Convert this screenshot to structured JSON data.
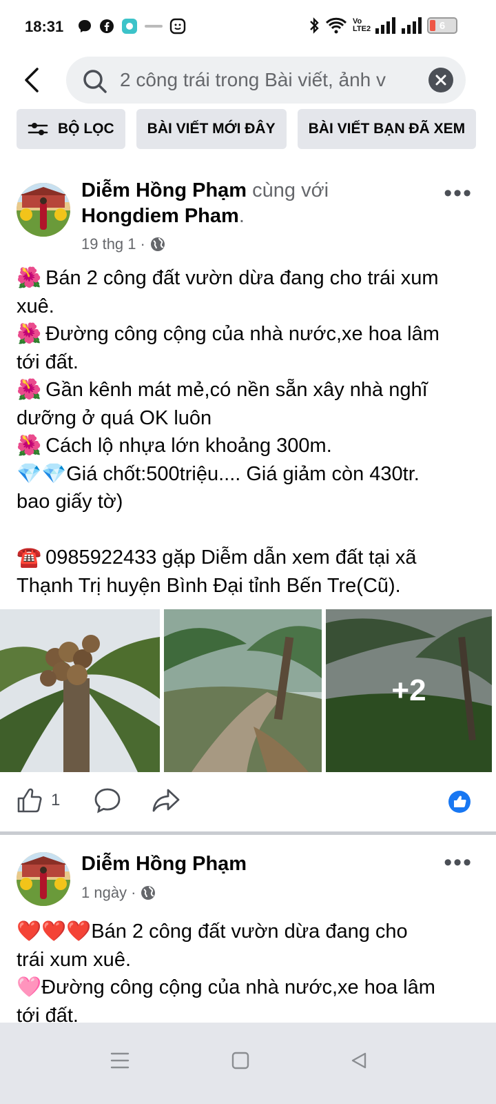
{
  "status_bar": {
    "time": "18:31",
    "battery": "6",
    "network_label": "Vo LTE2",
    "left_icons": [
      "chat-bubble-icon",
      "facebook-icon",
      "app-icon",
      "notification-icon",
      "smile-icon"
    ],
    "right_icons": [
      "bluetooth-icon",
      "wifi-icon",
      "signal-icon",
      "signal-icon",
      "battery-icon"
    ]
  },
  "search": {
    "query": "2 công trái trong Bài viết, ảnh v"
  },
  "filters": [
    {
      "label": "BỘ LỌC",
      "icon": "filter-icon"
    },
    {
      "label": "BÀI VIẾT MỚI ĐÂY"
    },
    {
      "label": "BÀI VIẾT BẠN ĐÃ XEM"
    }
  ],
  "posts": [
    {
      "author": "Diễm Hồng Phạm",
      "with_text": "cùng với",
      "tagged": "Hongdiem Pham",
      "tagged_suffix": ".",
      "time": "19 thg 1",
      "separator": "·",
      "privacy_icon": "globe-icon",
      "lines": [
        {
          "emoji": "🌺",
          "text": "Bán 2 công đất vườn dừa đang cho trái xum"
        },
        {
          "emoji": "",
          "text": "xuê."
        },
        {
          "emoji": "🌺",
          "text": "Đường công cộng của nhà nước,xe hoa lâm"
        },
        {
          "emoji": "",
          "text": "tới đất."
        },
        {
          "emoji": "🌺",
          "text": "Gần kênh mát mẻ,có nền sẵn xây nhà nghĩ"
        },
        {
          "emoji": "",
          "text": "dưỡng ở quá OK luôn"
        },
        {
          "emoji": "🌺",
          "text": "Cách lộ nhựa lớn khoảng 300m."
        },
        {
          "emoji": "💎💎",
          "text": "Giá chốt:500triệu.... Giá giảm còn 430tr."
        },
        {
          "emoji": "",
          "text": "bao giấy tờ)"
        },
        {
          "emoji": "",
          "text": " "
        },
        {
          "emoji": "☎️",
          "text": "0985922433 gặp Diễm dẫn xem đất tại xã"
        },
        {
          "emoji": "",
          "text": "Thạnh Trị huyện Bình Đại tỉnh Bến Tre(Cũ)."
        }
      ],
      "photo_more": "+2",
      "like_count": "1"
    },
    {
      "author": "Diễm Hồng Phạm",
      "time": "1 ngày",
      "separator": "·",
      "privacy_icon": "globe-icon",
      "lines": [
        {
          "emoji": "❤️❤️❤️",
          "text": "Bán 2 công đất vườn dừa đang cho"
        },
        {
          "emoji": "",
          "text": "trái xum xuê."
        },
        {
          "emoji": "🩷",
          "text": "Đường công cộng của nhà nước,xe hoa lâm"
        },
        {
          "emoji": "",
          "text": "tới đất."
        }
      ]
    }
  ],
  "nav": {
    "icons": [
      "recent-apps-icon",
      "home-icon",
      "back-icon"
    ]
  },
  "colors": {
    "like_blue": "#1877f2",
    "chip_bg": "#e4e6eb",
    "secondary_text": "#65676b"
  }
}
